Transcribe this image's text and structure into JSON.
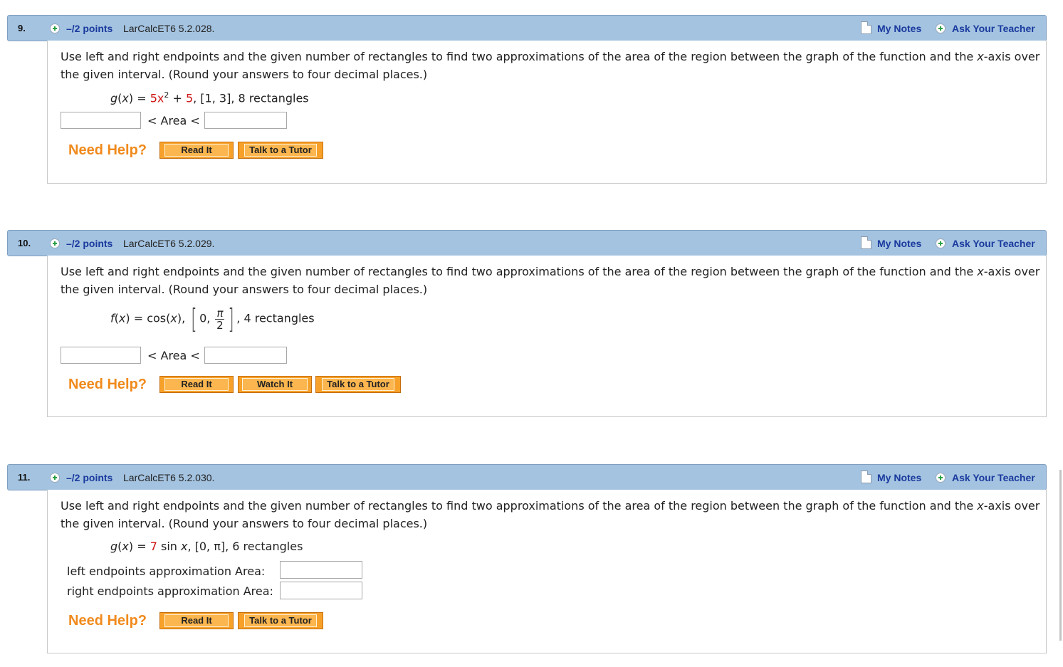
{
  "questions": [
    {
      "number": "9.",
      "points": "–/2 points",
      "source": "LarCalcET6 5.2.028.",
      "my_notes": "My Notes",
      "ask_teacher": "Ask Your Teacher",
      "prompt": "Use left and right endpoints and the given number of rectangles to find two approximations of the area of the region between the graph of the function and the x-axis over the given interval. (Round your answers to four decimal places.)",
      "formula": {
        "func": "g",
        "var": "x",
        "eq": " = ",
        "coef": "5x",
        "exp": "2",
        "plus": " + ",
        "const": "5",
        "rest": ", [1, 3], 8 rectangles"
      },
      "area_label": "< Area <",
      "need_help": "Need Help?",
      "buttons": [
        "Read It",
        "Talk to a Tutor"
      ]
    },
    {
      "number": "10.",
      "points": "–/2 points",
      "source": "LarCalcET6 5.2.029.",
      "my_notes": "My Notes",
      "ask_teacher": "Ask Your Teacher",
      "prompt": "Use left and right endpoints and the given number of rectangles to find two approximations of the area of the region between the graph of the function and the x-axis over the given interval. (Round your answers to four decimal places.)",
      "formula": {
        "func": "f",
        "var": "x",
        "eq": " = cos(",
        "close": "),",
        "interval_start": "0,",
        "frac_num": "π",
        "frac_den": "2",
        "rest": ", 4 rectangles"
      },
      "area_label": "< Area <",
      "need_help": "Need Help?",
      "buttons": [
        "Read It",
        "Watch It",
        "Talk to a Tutor"
      ]
    },
    {
      "number": "11.",
      "points": "–/2 points",
      "source": "LarCalcET6 5.2.030.",
      "my_notes": "My Notes",
      "ask_teacher": "Ask Your Teacher",
      "prompt": "Use left and right endpoints and the given number of rectangles to find two approximations of the area of the region between the graph of the function and the x-axis over the given interval. (Round your answers to four decimal places.)",
      "formula": {
        "func": "g",
        "var": "x",
        "eq": " = ",
        "coef": "7",
        "rest_a": " sin ",
        "rest_var": "x",
        "rest_b": ", [0, π], 6 rectangles"
      },
      "left_label": "left endpoints approximation Area:",
      "right_label": "right endpoints approximation Area:",
      "need_help": "Need Help?",
      "buttons": [
        "Read It",
        "Talk to a Tutor"
      ]
    }
  ],
  "colors": {
    "header_bg": "#a4c3e0",
    "link_blue": "#1a3a9e",
    "help_orange": "#f08a1c",
    "button_orange": "#f7a12a",
    "red_value": "#cc1111"
  }
}
